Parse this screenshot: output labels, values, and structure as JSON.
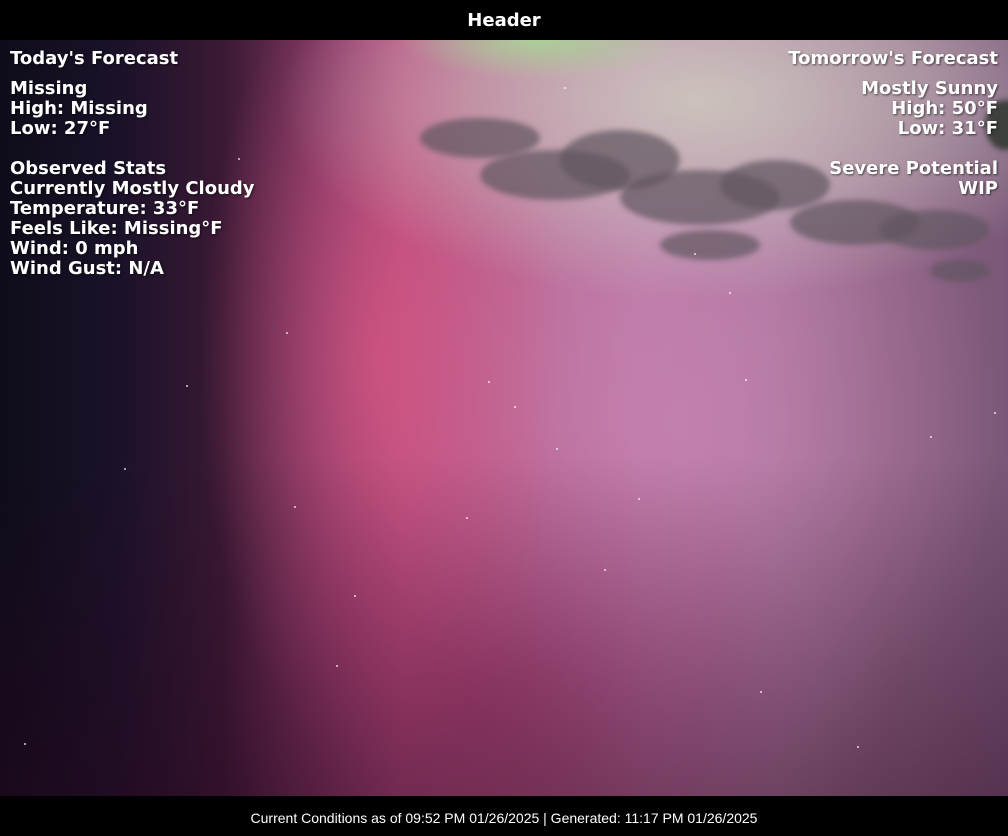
{
  "header": {
    "title": "Header"
  },
  "today": {
    "heading": "Today's Forecast",
    "condition": "Missing",
    "high": "High: Missing",
    "low": "Low: 27°F"
  },
  "observed": {
    "heading": "Observed Stats",
    "current": "Currently Mostly Cloudy",
    "temperature": "Temperature: 33°F",
    "feels_like": "Feels Like: Missing°F",
    "wind": "Wind: 0 mph",
    "wind_gust": "Wind Gust: N/A"
  },
  "tomorrow": {
    "heading": "Tomorrow's Forecast",
    "condition": "Mostly Sunny",
    "high": "High: 50°F",
    "low": "Low: 31°F"
  },
  "severe": {
    "heading": "Severe Potential",
    "value": "WIP"
  },
  "footer": {
    "text": "Current Conditions as of 09:52 PM 01/26/2025 | Generated: 11:17 PM 01/26/2025"
  }
}
